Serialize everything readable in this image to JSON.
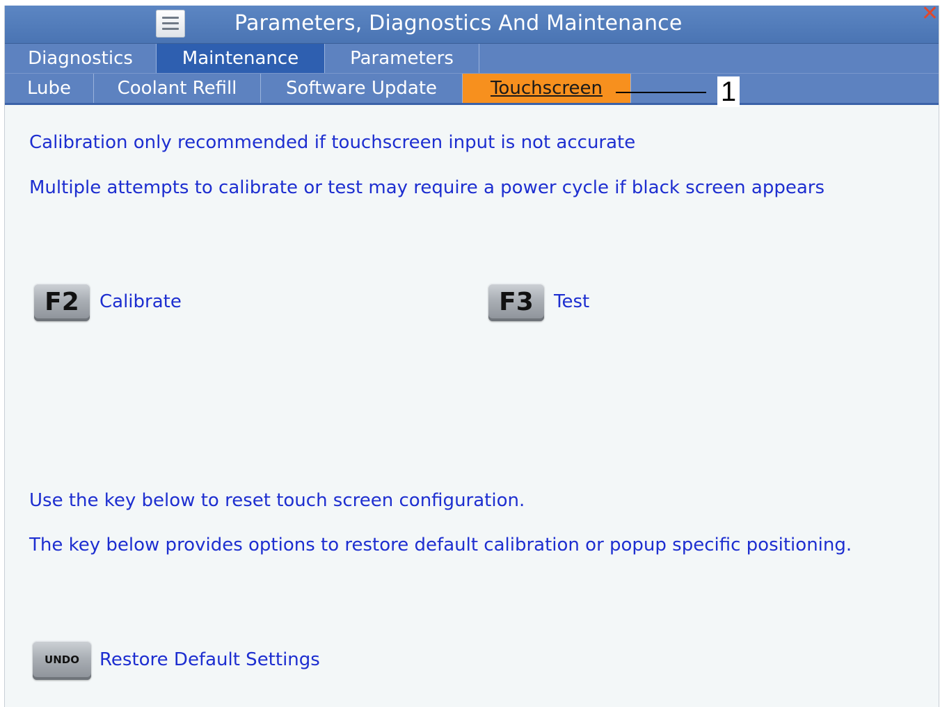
{
  "window": {
    "title": "Parameters, Diagnostics And Maintenance",
    "close_glyph": "✕"
  },
  "tabs_primary": [
    {
      "label": "Diagnostics"
    },
    {
      "label": "Maintenance"
    },
    {
      "label": "Parameters"
    }
  ],
  "tabs_secondary": [
    {
      "label": "Lube"
    },
    {
      "label": "Coolant Refill"
    },
    {
      "label": "Software Update"
    },
    {
      "label": "Touchscreen"
    }
  ],
  "callout": {
    "number": "1"
  },
  "messages": {
    "calibration_note": "Calibration only recommended if touchscreen input is not accurate",
    "power_cycle_note": "Multiple attempts to calibrate or test may require a power cycle if black screen appears",
    "reset_note": "Use the key below to reset touch screen configuration.",
    "restore_note": "The key below provides options to restore default calibration or popup specific positioning."
  },
  "actions": {
    "calibrate": {
      "key": "F2",
      "label": "Calibrate"
    },
    "test": {
      "key": "F3",
      "label": "Test"
    },
    "restore": {
      "key": "UNDO",
      "label": "Restore Default Settings"
    }
  },
  "colors": {
    "title_bar": "#4f7ab9",
    "tab_bar": "#5d82c0",
    "active_primary_tab": "#2e5fb0",
    "active_secondary_tab": "#f7901e",
    "message_text": "#1d2ed0",
    "close_x": "#e0482c"
  },
  "icons": {
    "menu": "hamburger-menu-icon",
    "close": "close-icon"
  }
}
